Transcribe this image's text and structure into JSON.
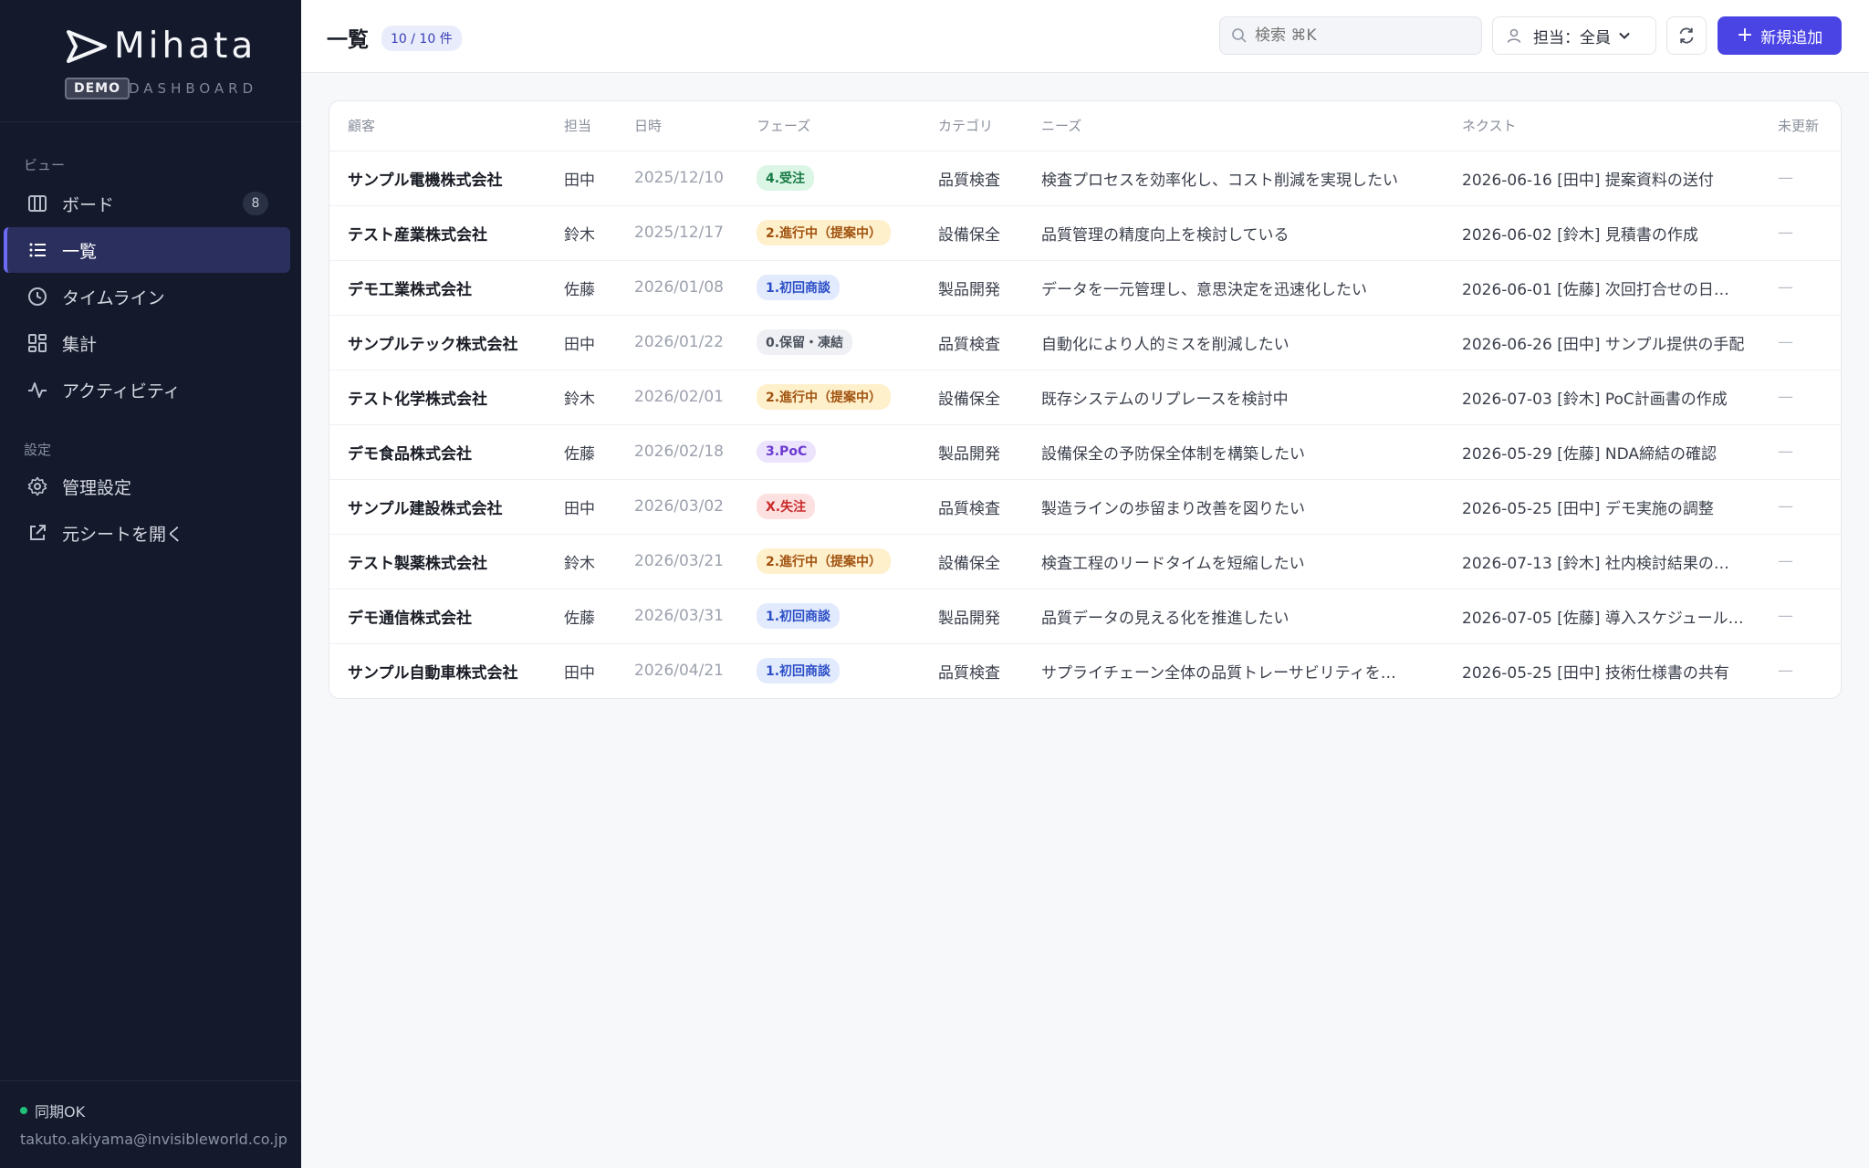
{
  "app": {
    "name": "Mihata",
    "demo_badge": "DEMO",
    "subtitle": "DASHBOARD"
  },
  "sidebar": {
    "views_label": "ビュー",
    "items": [
      {
        "label": "ボード",
        "icon": "board-icon",
        "count": "8"
      },
      {
        "label": "一覧",
        "icon": "list-icon",
        "active": true
      },
      {
        "label": "タイムライン",
        "icon": "clock-icon"
      },
      {
        "label": "集計",
        "icon": "grid-icon"
      },
      {
        "label": "アクティビティ",
        "icon": "activity-icon"
      }
    ],
    "settings_label": "設定",
    "settings_items": [
      {
        "label": "管理設定",
        "icon": "gear-icon"
      },
      {
        "label": "元シートを開く",
        "icon": "external-link-icon"
      }
    ],
    "sync_status": "同期OK",
    "user_email": "takuto.akiyama@invisibleworld.co.jp"
  },
  "header": {
    "title": "一覧",
    "count": "10 / 10 件",
    "search_placeholder": "検索 ⌘K",
    "owner_filter": "担当：全員",
    "add_button": "新規追加"
  },
  "table": {
    "columns": [
      "顧客",
      "担当",
      "日時",
      "フェーズ",
      "カテゴリ",
      "ニーズ",
      "ネクスト",
      "未更新"
    ],
    "rows": [
      {
        "customer": "サンプル電機株式会社",
        "owner": "田中",
        "date": "2025/12/10",
        "phase": "4.受注",
        "phase_kind": "won",
        "category": "品質検査",
        "needs": "検査プロセスを効率化し、コスト削減を実現したい",
        "next": "2026-06-16 [田中] 提案資料の送付",
        "stale": "—"
      },
      {
        "customer": "テスト産業株式会社",
        "owner": "鈴木",
        "date": "2025/12/17",
        "phase": "2.進行中（提案中）",
        "phase_kind": "progress",
        "category": "設備保全",
        "needs": "品質管理の精度向上を検討している",
        "next": "2026-06-02 [鈴木] 見積書の作成",
        "stale": "—"
      },
      {
        "customer": "デモ工業株式会社",
        "owner": "佐藤",
        "date": "2026/01/08",
        "phase": "1.初回商談",
        "phase_kind": "initial",
        "category": "製品開発",
        "needs": "データを一元管理し、意思決定を迅速化したい",
        "next": "2026-06-01 [佐藤] 次回打合せの日…",
        "stale": "—"
      },
      {
        "customer": "サンプルテック株式会社",
        "owner": "田中",
        "date": "2026/01/22",
        "phase": "0.保留・凍結",
        "phase_kind": "hold",
        "category": "品質検査",
        "needs": "自動化により人的ミスを削減したい",
        "next": "2026-06-26 [田中] サンプル提供の手配",
        "stale": "—"
      },
      {
        "customer": "テスト化学株式会社",
        "owner": "鈴木",
        "date": "2026/02/01",
        "phase": "2.進行中（提案中）",
        "phase_kind": "progress",
        "category": "設備保全",
        "needs": "既存システムのリプレースを検討中",
        "next": "2026-07-03 [鈴木] PoC計画書の作成",
        "stale": "—"
      },
      {
        "customer": "デモ食品株式会社",
        "owner": "佐藤",
        "date": "2026/02/18",
        "phase": "3.PoC",
        "phase_kind": "poc",
        "category": "製品開発",
        "needs": "設備保全の予防保全体制を構築したい",
        "next": "2026-05-29 [佐藤] NDA締結の確認",
        "stale": "—"
      },
      {
        "customer": "サンプル建設株式会社",
        "owner": "田中",
        "date": "2026/03/02",
        "phase": "X.失注",
        "phase_kind": "lost",
        "category": "品質検査",
        "needs": "製造ラインの歩留まり改善を図りたい",
        "next": "2026-05-25 [田中] デモ実施の調整",
        "stale": "—"
      },
      {
        "customer": "テスト製薬株式会社",
        "owner": "鈴木",
        "date": "2026/03/21",
        "phase": "2.進行中（提案中）",
        "phase_kind": "progress",
        "category": "設備保全",
        "needs": "検査工程のリードタイムを短縮したい",
        "next": "2026-07-13 [鈴木] 社内検討結果の…",
        "stale": "—"
      },
      {
        "customer": "デモ通信株式会社",
        "owner": "佐藤",
        "date": "2026/03/31",
        "phase": "1.初回商談",
        "phase_kind": "initial",
        "category": "製品開発",
        "needs": "品質データの見える化を推進したい",
        "next": "2026-07-05 [佐藤] 導入スケジュール…",
        "stale": "—"
      },
      {
        "customer": "サンプル自動車株式会社",
        "owner": "田中",
        "date": "2026/04/21",
        "phase": "1.初回商談",
        "phase_kind": "initial",
        "category": "品質検査",
        "needs": "サプライチェーン全体の品質トレーサビリティを…",
        "next": "2026-05-25 [田中] 技術仕様書の共有",
        "stale": "—"
      }
    ]
  },
  "colors": {
    "sidebar_bg": "#141a2c",
    "active_nav_bg": "#2a2f5e",
    "accent": "#4a44e5",
    "sync_ok": "#21c07a"
  }
}
